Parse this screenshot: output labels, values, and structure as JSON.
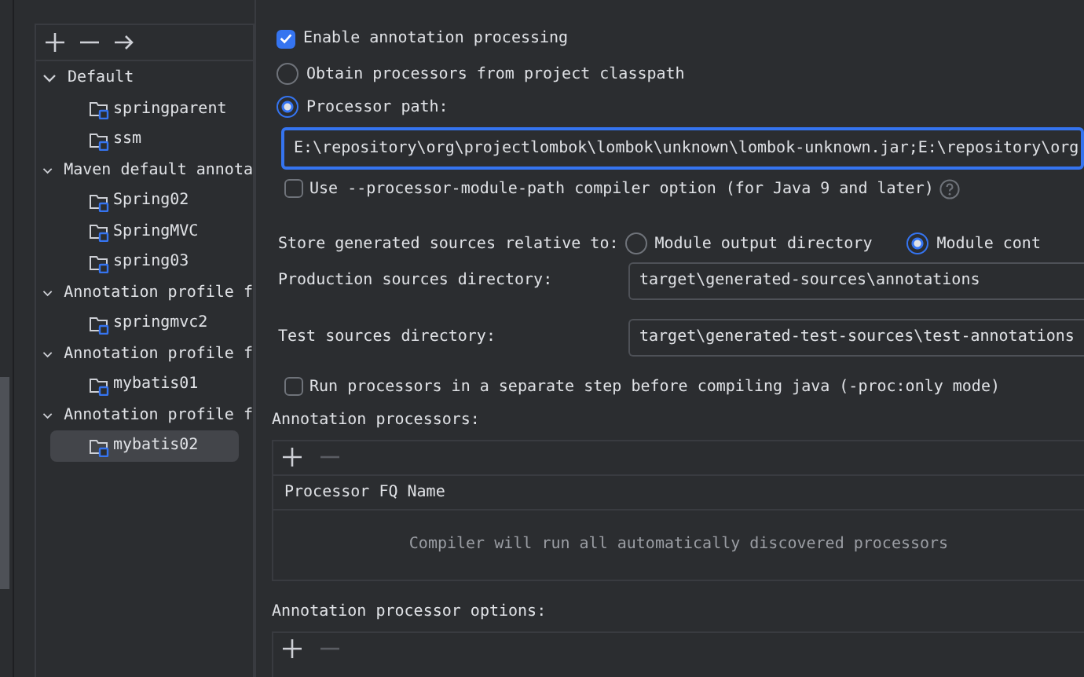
{
  "tree_toolbar": [
    {
      "kind": "add",
      "disabled": false
    },
    {
      "kind": "remove",
      "disabled": false
    },
    {
      "kind": "move",
      "disabled": false
    }
  ],
  "profiles": [
    {
      "label": "Default",
      "expanded": true,
      "children": [
        {
          "label": "springparent",
          "selected": false
        },
        {
          "label": "ssm",
          "selected": false
        }
      ]
    },
    {
      "label": "Maven default annota",
      "expanded": true,
      "children": [
        {
          "label": "Spring02",
          "selected": false
        },
        {
          "label": "SpringMVC",
          "selected": false
        },
        {
          "label": "spring03",
          "selected": false
        }
      ]
    },
    {
      "label": "Annotation profile f",
      "expanded": true,
      "children": [
        {
          "label": "springmvc2",
          "selected": false
        }
      ]
    },
    {
      "label": "Annotation profile f",
      "expanded": true,
      "children": [
        {
          "label": "mybatis01",
          "selected": false
        }
      ]
    },
    {
      "label": "Annotation profile f",
      "expanded": true,
      "children": [
        {
          "label": "mybatis02",
          "selected": true
        }
      ]
    }
  ],
  "enable_processing": {
    "label": "Enable annotation processing",
    "checked": true
  },
  "processor_source": [
    {
      "label": "Obtain processors from project classpath",
      "selected": false
    },
    {
      "label": "Processor path:",
      "selected": true
    }
  ],
  "processor_path": {
    "value": "E:\\repository\\org\\projectlombok\\lombok\\unknown\\lombok-unknown.jar;E:\\repository\\org",
    "focused": true
  },
  "module_path_option": {
    "label": "Use --processor-module-path compiler option (for Java 9 and later)",
    "checked": false
  },
  "store_generated": {
    "label": "Store generated sources relative to:",
    "options": [
      {
        "label": "Module output directory",
        "selected": false
      },
      {
        "label": "Module cont",
        "selected": true
      }
    ]
  },
  "production_sources": {
    "label": "Production sources directory:",
    "value": "target\\generated-sources\\annotations"
  },
  "test_sources": {
    "label": "Test sources directory:",
    "value": "target\\generated-test-sources\\test-annotations"
  },
  "separate_step": {
    "label": "Run processors in a separate step before compiling java (-proc:only mode)",
    "checked": false
  },
  "annotation_processors": {
    "title": "Annotation processors:",
    "toolbar": [
      {
        "kind": "add",
        "disabled": false
      },
      {
        "kind": "remove",
        "disabled": true
      }
    ],
    "column": "Processor FQ Name",
    "empty_text": "Compiler will run all automatically discovered processors"
  },
  "processor_options": {
    "title": "Annotation processor options:",
    "toolbar": [
      {
        "kind": "add",
        "disabled": false
      },
      {
        "kind": "remove",
        "disabled": true
      }
    ]
  }
}
